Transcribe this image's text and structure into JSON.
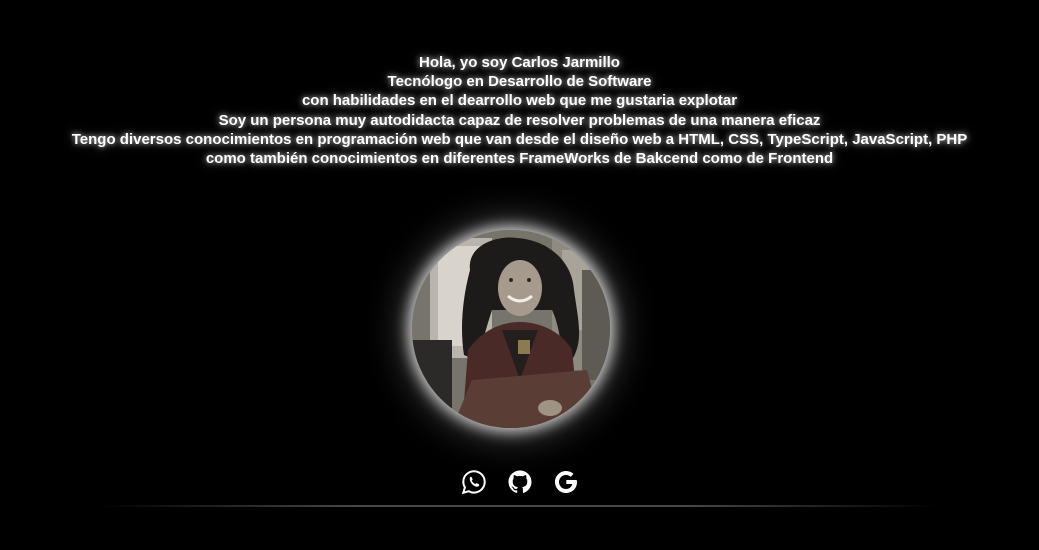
{
  "intro": {
    "lines": [
      "Hola, yo soy Carlos Jarmillo",
      "Tecnólogo en Desarrollo de Software",
      "con habilidades en el dearrollo web que me gustaria explotar",
      "Soy un persona muy autodidacta capaz de resolver problemas de una manera eficaz",
      "Tengo diversos conocimientos en programación web que van desde el diseño web a HTML, CSS, TypeScript, JavaScript, PHP",
      "como también conocimientos en diferentes FrameWorks de Bakcend como de Frontend"
    ]
  },
  "social": {
    "icons": [
      "whatsapp-icon",
      "github-icon",
      "google-icon"
    ]
  },
  "theme": {
    "background": "#000000",
    "text": "#ffffff",
    "glow": "#ffffff"
  }
}
